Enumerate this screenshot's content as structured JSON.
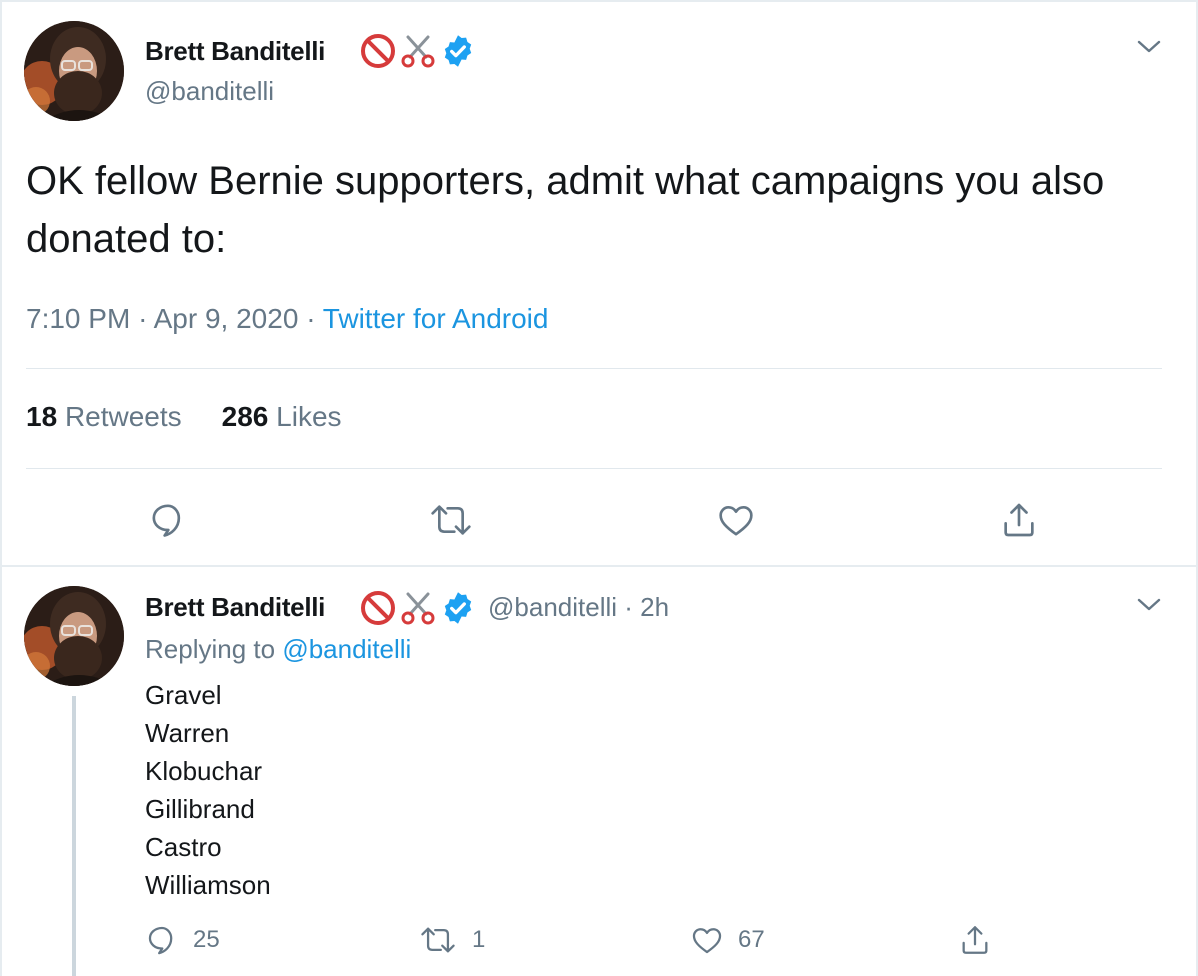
{
  "main_tweet": {
    "author": {
      "name": "Brett Banditelli",
      "handle": "@banditelli"
    },
    "badges": [
      "prohibited-emoji",
      "scissors-emoji",
      "verified-badge"
    ],
    "text": "OK fellow Bernie supporters, admit what campaigns you also donated to:",
    "time": "7:10 PM",
    "separator": "·",
    "date": "Apr 9, 2020",
    "source": "Twitter for Android",
    "stats": {
      "retweets_count": "18",
      "retweets_label": "Retweets",
      "likes_count": "286",
      "likes_label": "Likes"
    },
    "actions": [
      "reply-icon",
      "retweet-icon",
      "like-icon",
      "share-icon"
    ]
  },
  "reply_tweet": {
    "author": {
      "name": "Brett Banditelli",
      "handle": "@banditelli"
    },
    "separator": "·",
    "time_ago": "2h",
    "replying_label": "Replying to",
    "replying_to": "@banditelli",
    "lines": [
      "Gravel",
      "Warren",
      "Klobuchar",
      "Gillibrand",
      "Castro",
      "Williamson"
    ],
    "counts": {
      "replies": "25",
      "retweets": "1",
      "likes": "67"
    }
  },
  "colors": {
    "text": "#14171a",
    "secondary": "#657786",
    "link": "#1b95e0",
    "verified": "#1da1f2",
    "divider": "#e1e8ed",
    "thread_line": "#ccd6dd"
  }
}
